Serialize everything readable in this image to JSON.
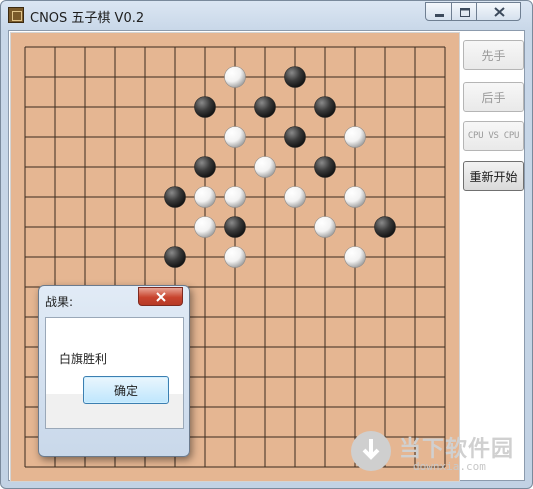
{
  "window": {
    "title": "CNOS 五子棋 V0.2",
    "icon": "gomoku-board-icon",
    "controls": [
      "minimize-icon",
      "maximize-icon",
      "close-icon"
    ]
  },
  "board": {
    "size": 15,
    "colors": {
      "board": "#e5b692",
      "grid": "#3a2a1e",
      "black_stone": "#3a3a3a",
      "white_stone": "#f2f2f2"
    },
    "black_stones": [
      [
        9,
        1
      ],
      [
        6,
        2
      ],
      [
        8,
        2
      ],
      [
        10,
        2
      ],
      [
        9,
        3
      ],
      [
        6,
        4
      ],
      [
        10,
        4
      ],
      [
        5,
        5
      ],
      [
        7,
        6
      ],
      [
        12,
        6
      ],
      [
        5,
        7
      ]
    ],
    "white_stones": [
      [
        7,
        1
      ],
      [
        7,
        3
      ],
      [
        11,
        3
      ],
      [
        8,
        4
      ],
      [
        6,
        5
      ],
      [
        7,
        5
      ],
      [
        9,
        5
      ],
      [
        11,
        5
      ],
      [
        6,
        6
      ],
      [
        10,
        6
      ],
      [
        7,
        7
      ],
      [
        11,
        7
      ]
    ]
  },
  "sidebar": {
    "buttons": [
      {
        "label": "先手",
        "enabled": false
      },
      {
        "label": "后手",
        "enabled": false
      },
      {
        "label": "CPU VS CPU",
        "enabled": false
      },
      {
        "label": "重新开始",
        "enabled": true
      }
    ]
  },
  "dialog": {
    "title": "战果:",
    "message": "白旗胜利",
    "ok_label": "确定",
    "close_icon": "close-icon"
  },
  "watermark": {
    "main": "当下软件园",
    "sub": "downxia.com",
    "icon": "download-arrow-icon"
  }
}
